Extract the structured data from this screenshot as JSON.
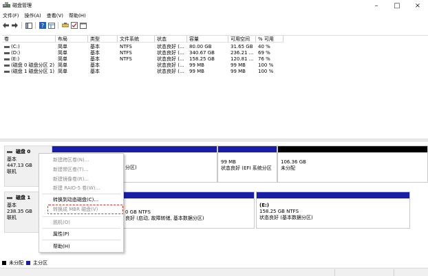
{
  "window": {
    "title": "磁盘管理",
    "minimize": "–",
    "maximize": "□",
    "close": "×"
  },
  "menu": [
    "文件(F)",
    "操作(A)",
    "查看(V)",
    "帮助(H)"
  ],
  "table": {
    "headers": [
      "卷",
      "布局",
      "类型",
      "文件系统",
      "状态",
      "容量",
      "可用空间",
      "% 可用"
    ],
    "rows": [
      [
        "(C:)",
        "简单",
        "基本",
        "NTFS",
        "状态良好 (...",
        "80.00 GB",
        "31.65 GB",
        "40 %"
      ],
      [
        "(D:)",
        "简单",
        "基本",
        "NTFS",
        "状态良好 (...",
        "340.67 GB",
        "236.21 ...",
        "69 %"
      ],
      [
        "(E:)",
        "简单",
        "基本",
        "NTFS",
        "状态良好 (...",
        "158.25 GB",
        "120.81 ...",
        "76 %"
      ],
      [
        "(磁盘 0 磁盘分区 2)",
        "简单",
        "基本",
        "",
        "状态良好 (...",
        "99 MB",
        "99 MB",
        "100 %"
      ],
      [
        "(磁盘 1 磁盘分区 1)",
        "简单",
        "基本",
        "",
        "状态良好 (...",
        "99 MB",
        "99 MB",
        "100 %"
      ]
    ]
  },
  "disks": [
    {
      "name": "磁盘 0",
      "type": "基本",
      "size": "447.13 GB",
      "state": "联机",
      "partitions": [
        {
          "line1": "",
          "line2": "分区)"
        },
        {
          "line1": "99 MB",
          "line2": "状态良好 (EFI 系统分区"
        },
        {
          "line1": "106.36 GB",
          "line2": "未分配"
        }
      ]
    },
    {
      "name": "磁盘 1",
      "type": "基本",
      "size": "238.35 GB",
      "state": "联机",
      "partitions": [
        {
          "line1": "0 GB NTFS",
          "line2": "良好 (启动, 故障转储, 基本数据分区)"
        },
        {
          "title": "(E:)",
          "line1": "158.25 GB NTFS",
          "line2": "状态良好 (基本数据分区)"
        }
      ]
    }
  ],
  "context_menu": {
    "items": [
      {
        "label": "新建跨区卷(N)...",
        "disabled": true
      },
      {
        "label": "新建带区卷(T)...",
        "disabled": true
      },
      {
        "label": "新建镜像卷(R)...",
        "disabled": true
      },
      {
        "label": "新建 RAID-5 卷(W)...",
        "disabled": true
      },
      {
        "label": "转换到动态磁盘(C)...",
        "disabled": false
      },
      {
        "label": "转换成 MBR 磁盘(V)",
        "disabled": true
      },
      {
        "label": "脱机(O)",
        "disabled": true
      },
      {
        "label": "属性(P)",
        "disabled": false
      },
      {
        "label": "帮助(H)",
        "disabled": false
      }
    ]
  },
  "legend": {
    "unallocated": "未分配",
    "primary": "主分区"
  },
  "colors": {
    "primary_bar": "#1a1ea6",
    "unallocated_bar": "#000000",
    "highlight": "#e0302a"
  }
}
